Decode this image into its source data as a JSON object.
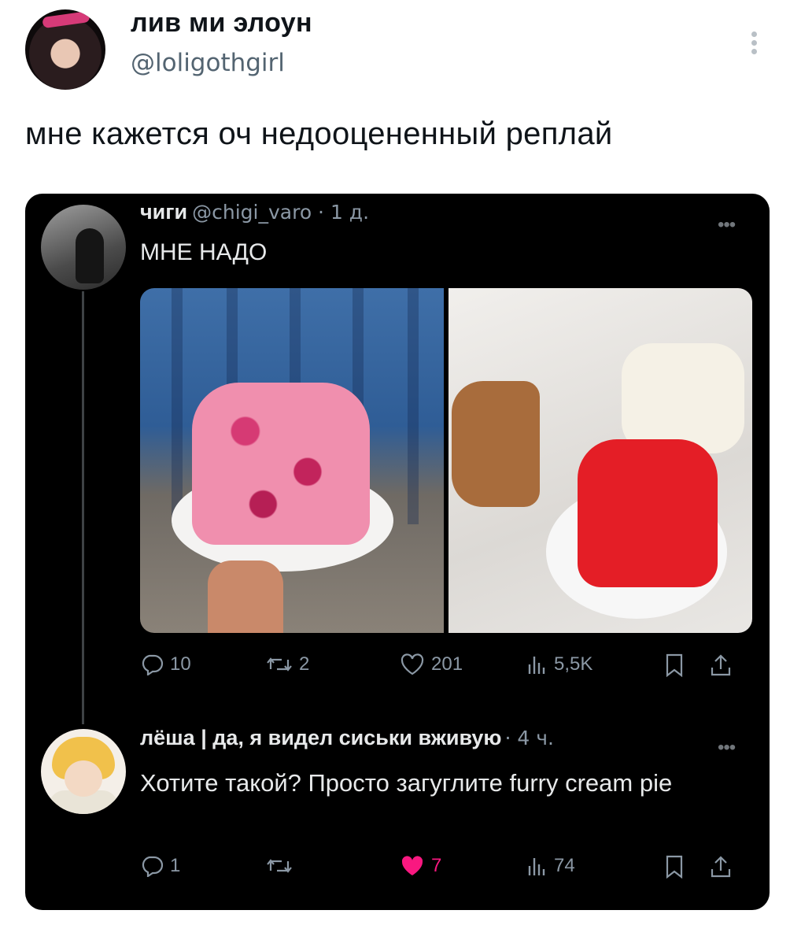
{
  "outer_tweet": {
    "author_name": "лив ми элоун",
    "author_handle": "@loligothgirl",
    "text": "мне кажется оч недооцененный реплай"
  },
  "embedded": {
    "tweet1": {
      "author_name": "чиги",
      "handle_time": "@chigi_varo · 1 д.",
      "text": "МНЕ НАДО",
      "replies": "10",
      "retweets": "2",
      "likes": "201",
      "views": "5,5K"
    },
    "tweet2": {
      "author_name": "лёша | да, я видел сиськи вживую",
      "time": "· 4 ч.",
      "text": "Хотите такой? Просто загуглите furry cream pie",
      "replies": "1",
      "likes": "7",
      "views": "74"
    }
  },
  "colors": {
    "embed_background": "#000000",
    "muted_text": "#8b98a5",
    "like_active": "#f91880"
  }
}
